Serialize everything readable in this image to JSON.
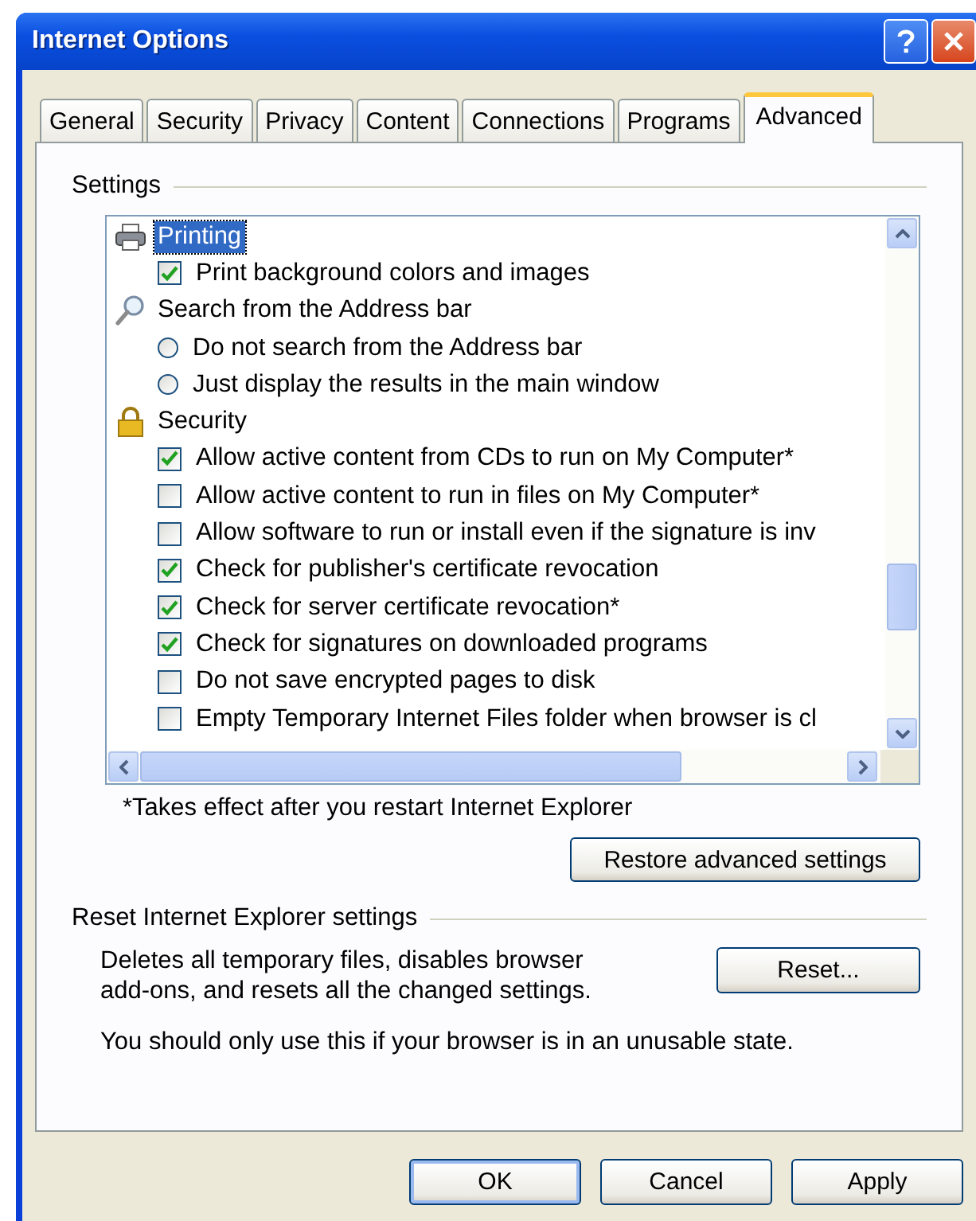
{
  "window": {
    "title": "Internet Options"
  },
  "tabs": [
    {
      "label": "General",
      "selected": false
    },
    {
      "label": "Security",
      "selected": false
    },
    {
      "label": "Privacy",
      "selected": false
    },
    {
      "label": "Content",
      "selected": false
    },
    {
      "label": "Connections",
      "selected": false
    },
    {
      "label": "Programs",
      "selected": false
    },
    {
      "label": "Advanced",
      "selected": true
    }
  ],
  "settings": {
    "label": "Settings",
    "items": [
      {
        "kind": "category",
        "label": "Printing",
        "selected": true,
        "children": [
          {
            "kind": "checkbox",
            "label": "Print background colors and images",
            "checked": true
          }
        ]
      },
      {
        "kind": "category",
        "label": "Search from the Address bar",
        "selected": false,
        "children": [
          {
            "kind": "radio",
            "label": "Do not search from the Address bar",
            "checked": false
          },
          {
            "kind": "radio",
            "label": "Just display the results in the main window",
            "checked": false
          }
        ]
      },
      {
        "kind": "category",
        "label": "Security",
        "selected": false,
        "children": [
          {
            "kind": "checkbox",
            "label": "Allow active content from CDs to run on My Computer*",
            "checked": true
          },
          {
            "kind": "checkbox",
            "label": "Allow active content to run in files on My Computer*",
            "checked": false
          },
          {
            "kind": "checkbox",
            "label": "Allow software to run or install even if the signature is inv",
            "checked": false
          },
          {
            "kind": "checkbox",
            "label": "Check for publisher's certificate revocation",
            "checked": true
          },
          {
            "kind": "checkbox",
            "label": "Check for server certificate revocation*",
            "checked": true
          },
          {
            "kind": "checkbox",
            "label": "Check for signatures on downloaded programs",
            "checked": true
          },
          {
            "kind": "checkbox",
            "label": "Do not save encrypted pages to disk",
            "checked": false
          },
          {
            "kind": "checkbox",
            "label": "Empty Temporary Internet Files folder when browser is cl",
            "checked": false
          }
        ]
      }
    ],
    "footnote": "*Takes effect after you restart Internet Explorer",
    "restore_button": "Restore advanced settings"
  },
  "reset": {
    "label": "Reset Internet Explorer settings",
    "description": "Deletes all temporary files, disables browser add-ons, and resets all the changed settings.",
    "button": "Reset...",
    "note": "You should only use this if your browser is in an unusable state."
  },
  "buttons": [
    {
      "label": "OK",
      "default": true
    },
    {
      "label": "Cancel",
      "default": false
    },
    {
      "label": "Apply",
      "default": false
    }
  ]
}
